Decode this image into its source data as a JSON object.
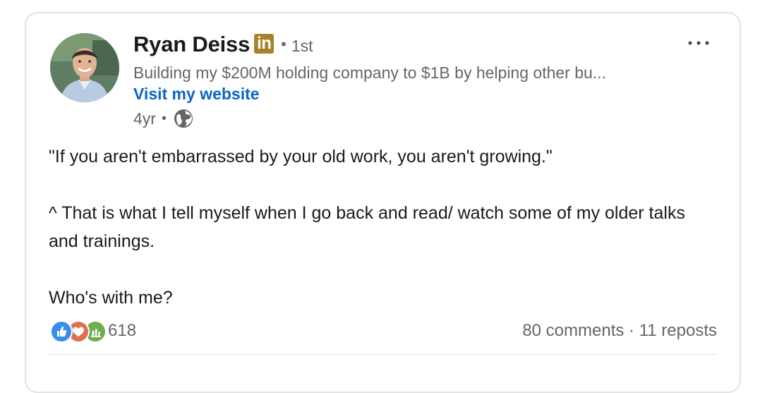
{
  "author": {
    "name": "Ryan Deiss",
    "badge": "in",
    "degree": "1st",
    "headline": "Building my $200M holding company to $1B by helping other bu...",
    "website_link": "Visit my website"
  },
  "post": {
    "time": "4yr",
    "visibility_icon": "globe-icon",
    "paragraphs": [
      "\"If you aren't embarrassed by your old work, you aren't growing.\"",
      "^ That is what I tell myself when I go back and read/ watch some of my older talks and trainings.",
      "Who's with me?"
    ]
  },
  "social": {
    "reaction_icons": [
      "like-icon",
      "love-icon",
      "celebrate-icon"
    ],
    "reaction_count": "618",
    "comments": "80 comments",
    "separator": "·",
    "reposts": "11 reposts"
  },
  "colors": {
    "link_blue": "#0a66c2",
    "badge_gold": "#a8822b",
    "text_primary": "#1a1a1a",
    "text_secondary": "#666666"
  }
}
